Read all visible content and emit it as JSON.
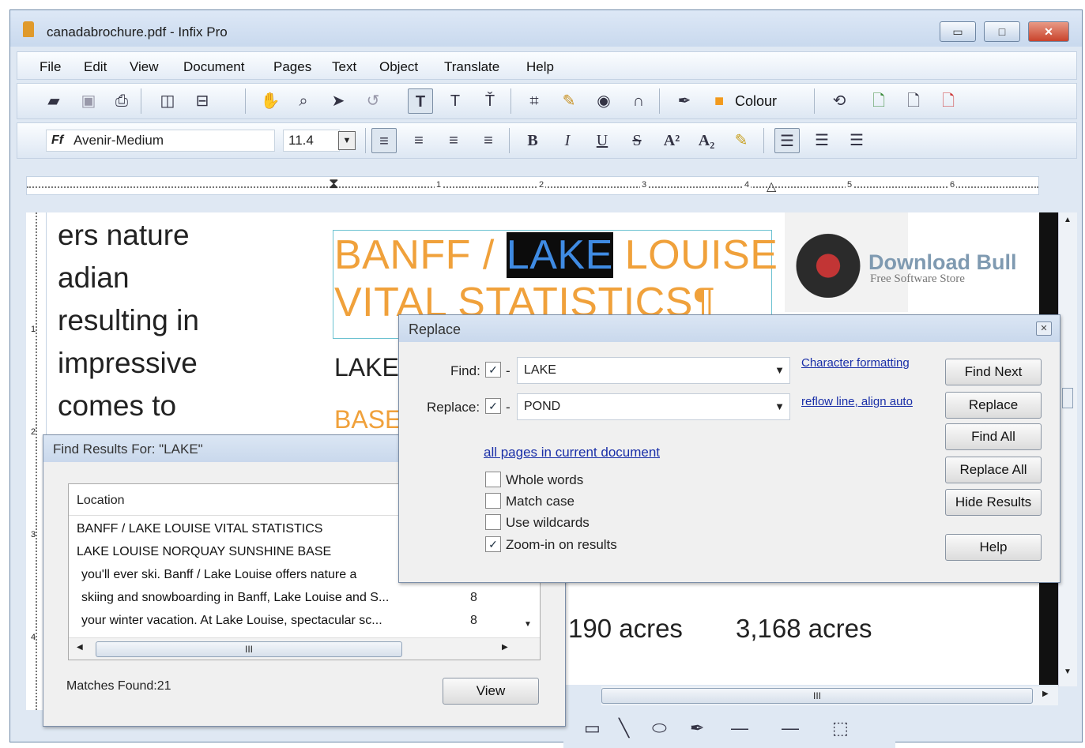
{
  "window": {
    "title": "canadabrochure.pdf - Infix Pro",
    "min": "▭",
    "max": "□",
    "close": "✕"
  },
  "menu": [
    "File",
    "Edit",
    "View",
    "Document",
    "Pages",
    "Text",
    "Object",
    "Translate",
    "Help"
  ],
  "format_bar": {
    "font": "Avenir-Medium",
    "font_icon": "Ff",
    "size": "11.4"
  },
  "toolbar": {
    "colour_label": "Colour"
  },
  "ruler": {
    "marks": [
      "1",
      "2",
      "3",
      "4",
      "5",
      "6"
    ],
    "v_marks": [
      "1",
      "2",
      "3",
      "4"
    ]
  },
  "document": {
    "left_lines": [
      "ers nature",
      "adian",
      "resulting in",
      "impressive",
      "comes to"
    ],
    "heading_line1_a": "BANFF / ",
    "heading_highlight": "LAKE",
    "heading_line1_b": " LOUISE",
    "heading_line2": "VITAL STATISTICS¶",
    "sub1": "LAKE",
    "sub2": "BASE",
    "acres1": "190 acres",
    "acres2": "3,168 acres",
    "logo_title": "Download Bull",
    "logo_sub": "Free Software Store"
  },
  "replace_dialog": {
    "title": "Replace",
    "find_label": "Find:",
    "find_value": "LAKE",
    "replace_label": "Replace:",
    "replace_value": "POND",
    "char_format_link": "Character formatting",
    "reflow_link": "reflow line, align auto",
    "scope_link": "all pages in current document",
    "options": [
      {
        "label": "Whole words",
        "checked": false
      },
      {
        "label": "Match case",
        "checked": false
      },
      {
        "label": "Use wildcards",
        "checked": false
      },
      {
        "label": "Zoom-in on results",
        "checked": true
      }
    ],
    "buttons": {
      "find_next": "Find Next",
      "replace": "Replace",
      "find_all": "Find All",
      "replace_all": "Replace All",
      "hide_results": "Hide Results",
      "help": "Help"
    }
  },
  "results_dialog": {
    "title": "Find Results For: \"LAKE\"",
    "column": "Location",
    "rows": [
      {
        "text": "BANFF / LAKE LOUISE VITAL STATISTICS",
        "num": ""
      },
      {
        "text": "LAKE LOUISE NORQUAY SUNSHINE BASE",
        "num": ""
      },
      {
        "text": "you'll ever ski. Banff / Lake Louise offers nature a",
        "num": ""
      },
      {
        "text": "skiing and snowboarding in Banff, Lake Louise and S...",
        "num": "8"
      },
      {
        "text": "your winter vacation. At Lake Louise, spectacular sc...",
        "num": "8"
      }
    ],
    "matches": "Matches Found:21",
    "view_button": "View",
    "hscroll_grip": "III"
  },
  "main_hscroll_grip": "III"
}
